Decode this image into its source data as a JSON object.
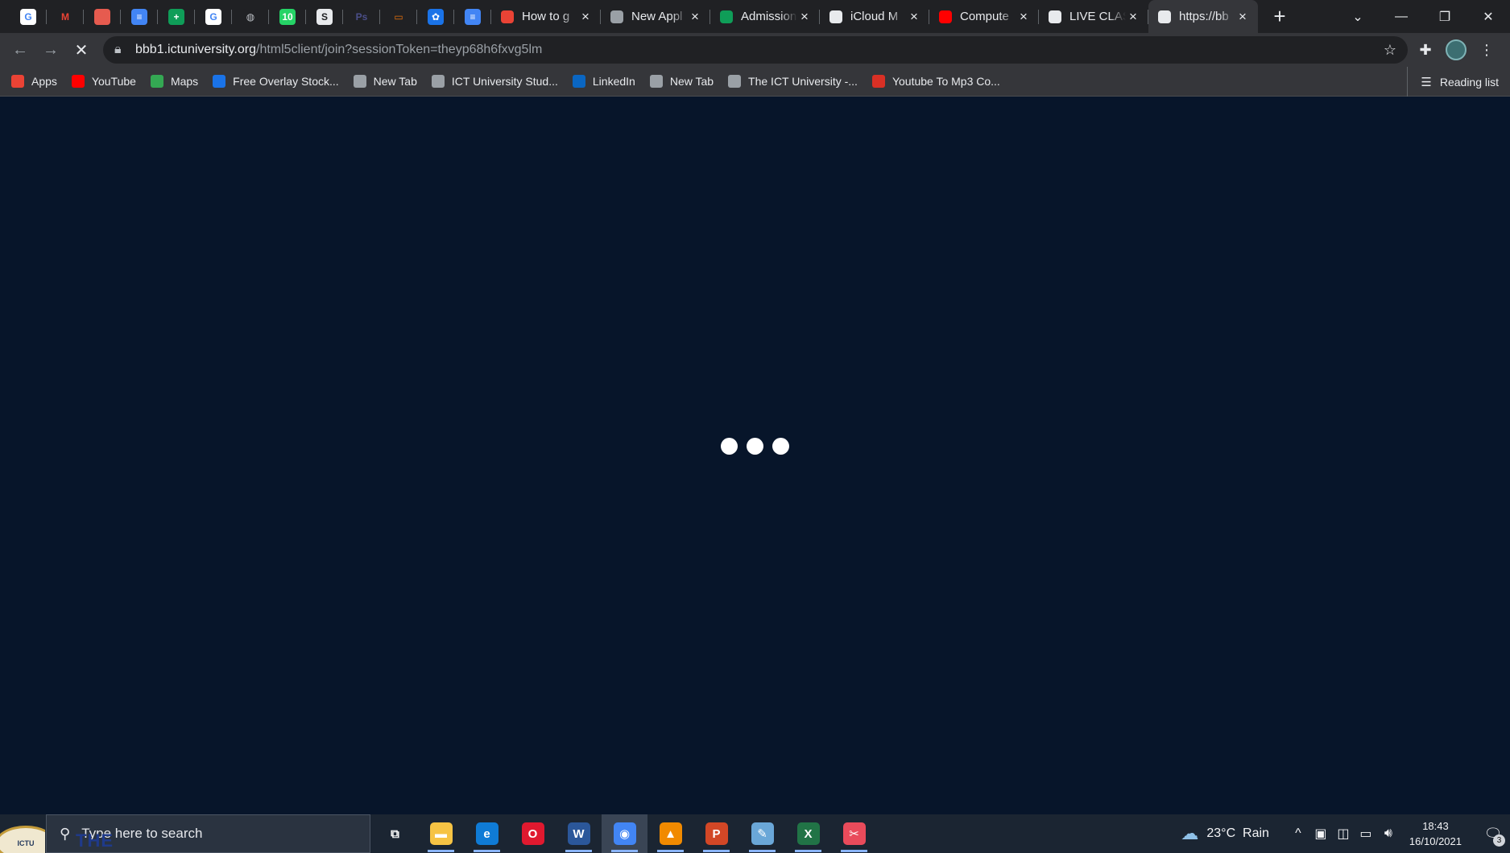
{
  "browser": {
    "tabs": [
      {
        "title": "How to g",
        "icon": "gmail-icon",
        "color": "#ea4335"
      },
      {
        "title": "New Appl",
        "icon": "gear-icon",
        "color": "#9aa0a6"
      },
      {
        "title": "Admission",
        "icon": "sheets-icon",
        "color": "#0f9d58"
      },
      {
        "title": "iCloud M",
        "icon": "apple-icon",
        "color": "#e8eaed"
      },
      {
        "title": "Compute",
        "icon": "youtube-icon",
        "color": "#ff0000"
      },
      {
        "title": "LIVE CLAS",
        "icon": "moodle-icon",
        "color": "#e8eaed"
      },
      {
        "title": "https://bb",
        "icon": "loading-icon",
        "color": "#e8eaed"
      }
    ],
    "pinned_tabs": [
      {
        "icon": "google-icon",
        "glyph": "G",
        "color": "#ffffff",
        "text": "#4285f4"
      },
      {
        "icon": "gmail-icon",
        "glyph": "M",
        "color": "#202124",
        "text": "#ea4335"
      },
      {
        "icon": "pdf-icon",
        "glyph": "",
        "color": "#e65b4f",
        "text": "#fff"
      },
      {
        "icon": "docs-icon",
        "glyph": "≡",
        "color": "#4285f4",
        "text": "#fff"
      },
      {
        "icon": "sheets-icon",
        "glyph": "+",
        "color": "#0f9d58",
        "text": "#fff"
      },
      {
        "icon": "google-icon",
        "glyph": "G",
        "color": "#ffffff",
        "text": "#4285f4"
      },
      {
        "icon": "globe-icon",
        "glyph": "◍",
        "color": "#202124",
        "text": "#bdc1c6"
      },
      {
        "icon": "whatsapp-icon",
        "glyph": "10",
        "color": "#25d366",
        "text": "#fff"
      },
      {
        "icon": "scribd-icon",
        "glyph": "S",
        "color": "#e8eaed",
        "text": "#202124"
      },
      {
        "icon": "photoshop-icon",
        "glyph": "Ps",
        "color": "#202124",
        "text": "#4b4f8a"
      },
      {
        "icon": "slides-icon",
        "glyph": "▭",
        "color": "#202124",
        "text": "#e8710a"
      },
      {
        "icon": "settings-icon",
        "glyph": "✿",
        "color": "#1a73e8",
        "text": "#fff"
      },
      {
        "icon": "docs-icon",
        "glyph": "≡",
        "color": "#4285f4",
        "text": "#fff"
      }
    ],
    "url_host": "bbb1.ictuniversity.org",
    "url_path": "/html5client/join?sessionToken=theyp68h6fxvg5lm",
    "bookmarks": [
      {
        "label": "Apps",
        "icon": "apps-grid-icon",
        "color": "#ea4335"
      },
      {
        "label": "YouTube",
        "icon": "youtube-icon",
        "color": "#ff0000"
      },
      {
        "label": "Maps",
        "icon": "maps-pin-icon",
        "color": "#34a853"
      },
      {
        "label": "Free Overlay Stock...",
        "icon": "v-logo-icon",
        "color": "#1a73e8"
      },
      {
        "label": "New Tab",
        "icon": "shield-icon",
        "color": "#9aa0a6"
      },
      {
        "label": "ICT University Stud...",
        "icon": "people-icon",
        "color": "#9aa0a6"
      },
      {
        "label": "LinkedIn",
        "icon": "linkedin-icon",
        "color": "#0a66c2"
      },
      {
        "label": "New Tab",
        "icon": "globe-icon",
        "color": "#9aa0a6"
      },
      {
        "label": "The ICT University -...",
        "icon": "shield-icon",
        "color": "#9aa0a6"
      },
      {
        "label": "Youtube To Mp3 Co...",
        "icon": "download-icon",
        "color": "#d93025"
      }
    ],
    "reading_list_label": "Reading list"
  },
  "taskbar": {
    "search_placeholder": "Type here to search",
    "start_logo_text": "ICTU",
    "overlay_word": "THE",
    "apps": [
      {
        "icon": "task-view-icon",
        "glyph": "⧉",
        "color": "transparent",
        "running": false
      },
      {
        "icon": "file-explorer-icon",
        "glyph": "▬",
        "color": "#f6c344",
        "running": true
      },
      {
        "icon": "edge-icon",
        "glyph": "e",
        "color": "#0f7bd6",
        "running": true
      },
      {
        "icon": "opera-icon",
        "glyph": "O",
        "color": "#e0192f",
        "running": false
      },
      {
        "icon": "word-icon",
        "glyph": "W",
        "color": "#2b579a",
        "running": true
      },
      {
        "icon": "chrome-icon",
        "glyph": "◉",
        "color": "#4285f4",
        "running": true,
        "active": true
      },
      {
        "icon": "vlc-icon",
        "glyph": "▲",
        "color": "#f18a00",
        "running": true
      },
      {
        "icon": "powerpoint-icon",
        "glyph": "P",
        "color": "#d24726",
        "running": true
      },
      {
        "icon": "notepad-icon",
        "glyph": "✎",
        "color": "#6aa7d8",
        "running": true
      },
      {
        "icon": "excel-icon",
        "glyph": "X",
        "color": "#217346",
        "running": true
      },
      {
        "icon": "snipping-icon",
        "glyph": "✂",
        "color": "#e94b5b",
        "running": true
      }
    ],
    "weather_temp": "23°C",
    "weather_desc": "Rain",
    "time": "18:43",
    "date": "16/10/2021",
    "notification_count": "3"
  }
}
